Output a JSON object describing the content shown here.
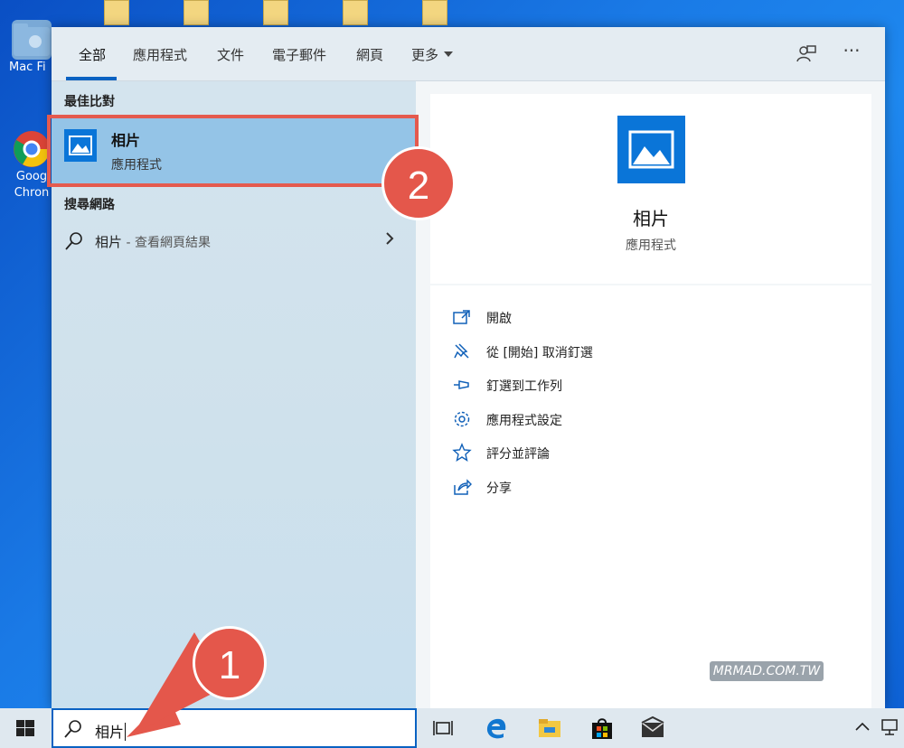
{
  "desktop": {
    "icons": [
      {
        "label": "Mac Fi",
        "name": "mac-files-shortcut"
      },
      {
        "label": "Goog Chron",
        "name": "google-chrome-shortcut"
      }
    ]
  },
  "search_panel": {
    "tabs": [
      {
        "label": "全部",
        "active": true
      },
      {
        "label": "應用程式"
      },
      {
        "label": "文件"
      },
      {
        "label": "電子郵件"
      },
      {
        "label": "網頁"
      },
      {
        "label": "更多"
      }
    ],
    "toolbar_icons": [
      "feedback-icon",
      "more-options-icon"
    ],
    "best_match_title": "最佳比對",
    "best_match": {
      "name": "相片",
      "type": "應用程式",
      "icon": "photos-app-icon"
    },
    "web_section_title": "搜尋網路",
    "web_result": {
      "query": "相片",
      "suffix": " - 查看網頁結果"
    },
    "preview": {
      "name": "相片",
      "type": "應用程式"
    },
    "actions": [
      {
        "label": "開啟",
        "icon": "open-icon"
      },
      {
        "label": "從 [開始] 取消釘選",
        "icon": "unpin-icon"
      },
      {
        "label": "釘選到工作列",
        "icon": "pin-taskbar-icon"
      },
      {
        "label": "應用程式設定",
        "icon": "gear-icon"
      },
      {
        "label": "評分並評論",
        "icon": "star-icon"
      },
      {
        "label": "分享",
        "icon": "share-icon"
      }
    ]
  },
  "watermark": "MRMAD.COM.TW",
  "taskbar": {
    "search_value": "相片",
    "apps": [
      "task-view-icon",
      "edge-icon",
      "file-explorer-icon",
      "store-icon",
      "mail-icon"
    ],
    "tray_icons": [
      "chevron-up-icon",
      "network-icon"
    ]
  },
  "annotations": {
    "step1": "1",
    "step2": "2"
  },
  "colors": {
    "accent": "#0a62c2",
    "highlight": "#94c4e7",
    "callout": "#e4574b",
    "app_icon": "#0a75d8"
  }
}
